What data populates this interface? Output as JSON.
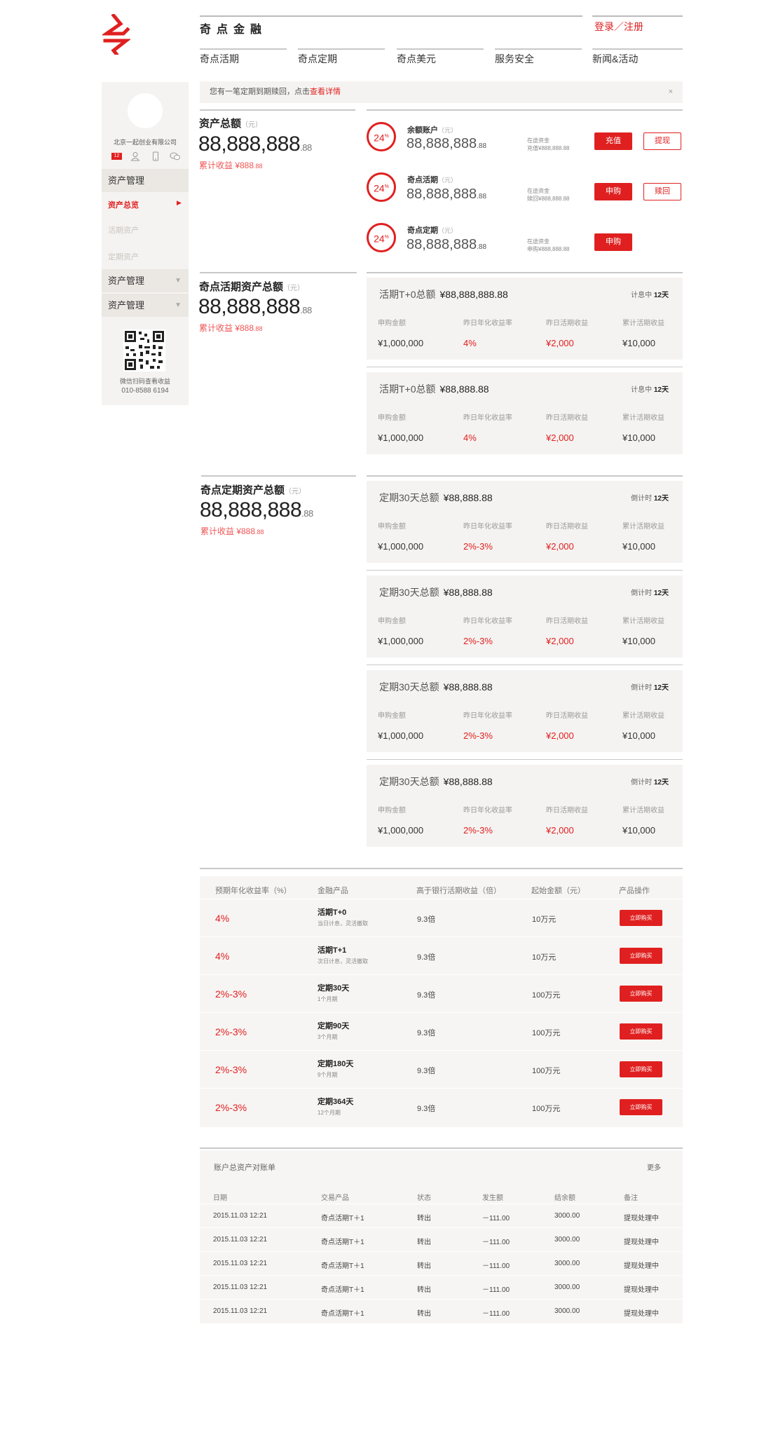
{
  "brand": {
    "name": "奇点金融",
    "logo_icon": "qidian-logo-icon",
    "accent": "#e02020"
  },
  "header": {
    "login_label": "登录／注册",
    "nav": [
      "奇点活期",
      "奇点定期",
      "奇点美元",
      "服务安全",
      "新闻&活动"
    ]
  },
  "sidebar": {
    "company": "北京一起创业有限公司",
    "message_count": "12",
    "icons": [
      "message-icon",
      "user-icon",
      "phone-icon",
      "wechat-icon"
    ],
    "sections": [
      {
        "label": "资产管理",
        "expanded": true,
        "items": [
          {
            "label": "资产总览",
            "active": true
          },
          {
            "label": "活期资产",
            "active": false
          },
          {
            "label": "定期资产",
            "active": false
          }
        ]
      },
      {
        "label": "资产管理",
        "expanded": false
      },
      {
        "label": "资产管理",
        "expanded": false
      }
    ],
    "qr_caption": "微信扫码查看收益",
    "phone": "010-8588 6194"
  },
  "notice": {
    "text": "您有一笔定期到期赎回，点击",
    "link": "查看详情",
    "close": "×"
  },
  "total": {
    "title": "资产总额",
    "unit": "（元）",
    "amount": "88,888,888",
    "cents": ".88",
    "cum_label": "累计收益 ¥888",
    "cum_cents": ".88"
  },
  "accounts": [
    {
      "rate": "24",
      "rate_unit": "%",
      "name": "余额账户",
      "unit": "（元）",
      "amount": "88,888,888",
      "cents": ".88",
      "meta1": "在途资金",
      "meta2": "充值¥888,888.88",
      "btn1": "充值",
      "btn2": "提现"
    },
    {
      "rate": "24",
      "rate_unit": "%",
      "name": "奇点活期",
      "unit": "（元）",
      "amount": "88,888,888",
      "cents": ".88",
      "meta1": "在途资金",
      "meta2": "赎回¥888,888.88",
      "btn1": "申购",
      "btn2": "赎回"
    },
    {
      "rate": "24",
      "rate_unit": "%",
      "name": "奇点定期",
      "unit": "（元）",
      "amount": "88,888,888",
      "cents": ".88",
      "meta1": "在途资金",
      "meta2": "申购¥888,888.88",
      "btn1": "申购",
      "btn2": ""
    }
  ],
  "current_section": {
    "title": "奇点活期资产总额",
    "unit": "（元）",
    "amount": "88,888,888",
    "cents": ".88",
    "cum_label": "累计收益 ¥888",
    "cum_cents": ".88"
  },
  "current_cards": [
    {
      "title": "活期T+0总额",
      "total": "¥88,888,888.88",
      "status": "计息中",
      "days": "12天",
      "labels": [
        "申购金额",
        "昨日年化收益率",
        "昨日活期收益",
        "累计活期收益"
      ],
      "values": [
        "¥1,000,000",
        "4%",
        "¥2,000",
        "¥10,000"
      ]
    },
    {
      "title": "活期T+0总额",
      "total": "¥88,888.88",
      "status": "计息中",
      "days": "12天",
      "labels": [
        "申购金额",
        "昨日年化收益率",
        "昨日活期收益",
        "累计活期收益"
      ],
      "values": [
        "¥1,000,000",
        "4%",
        "¥2,000",
        "¥10,000"
      ]
    }
  ],
  "fixed_section": {
    "title": "奇点定期资产总额",
    "unit": "（元）",
    "amount": "88,888,888",
    "cents": ".88",
    "cum_label": "累计收益 ¥888",
    "cum_cents": ".88"
  },
  "fixed_cards": [
    {
      "title": "定期30天总额",
      "total": "¥88,888.88",
      "status": "倒计时",
      "days": "12天",
      "labels": [
        "申购金额",
        "昨日年化收益率",
        "昨日活期收益",
        "累计活期收益"
      ],
      "values": [
        "¥1,000,000",
        "2%-3%",
        "¥2,000",
        "¥10,000"
      ]
    },
    {
      "title": "定期30天总额",
      "total": "¥88,888.88",
      "status": "倒计时",
      "days": "12天",
      "labels": [
        "申购金额",
        "昨日年化收益率",
        "昨日活期收益",
        "累计活期收益"
      ],
      "values": [
        "¥1,000,000",
        "2%-3%",
        "¥2,000",
        "¥10,000"
      ]
    },
    {
      "title": "定期30天总额",
      "total": "¥88,888.88",
      "status": "倒计时",
      "days": "12天",
      "labels": [
        "申购金额",
        "昨日年化收益率",
        "昨日活期收益",
        "累计活期收益"
      ],
      "values": [
        "¥1,000,000",
        "2%-3%",
        "¥2,000",
        "¥10,000"
      ]
    },
    {
      "title": "定期30天总额",
      "total": "¥88,888.88",
      "status": "倒计时",
      "days": "12天",
      "labels": [
        "申购金额",
        "昨日年化收益率",
        "昨日活期收益",
        "累计活期收益"
      ],
      "values": [
        "¥1,000,000",
        "2%-3%",
        "¥2,000",
        "¥10,000"
      ]
    }
  ],
  "products": {
    "headers": [
      "预期年化收益率（%）",
      "金融产品",
      "高于银行活期收益（倍）",
      "起始金额（元）",
      "产品操作"
    ],
    "rows": [
      {
        "rate": "4%",
        "name": "活期T+0",
        "sub": "当日计息，灵活撤取",
        "multiple": "9.3倍",
        "min": "10万元",
        "action": "立即购买"
      },
      {
        "rate": "4%",
        "name": "活期T+1",
        "sub": "次日计息，灵活撤取",
        "multiple": "9.3倍",
        "min": "10万元",
        "action": "立即购买"
      },
      {
        "rate": "2%-3%",
        "name": "定期30天",
        "sub": "1个月期",
        "multiple": "9.3倍",
        "min": "100万元",
        "action": "立即购买"
      },
      {
        "rate": "2%-3%",
        "name": "定期90天",
        "sub": "3个月期",
        "multiple": "9.3倍",
        "min": "100万元",
        "action": "立即购买"
      },
      {
        "rate": "2%-3%",
        "name": "定期180天",
        "sub": "9个月期",
        "multiple": "9.3倍",
        "min": "100万元",
        "action": "立即购买"
      },
      {
        "rate": "2%-3%",
        "name": "定期364天",
        "sub": "12个月期",
        "multiple": "9.3倍",
        "min": "100万元",
        "action": "立即购买"
      }
    ]
  },
  "statement": {
    "title": "账户总资产对账单",
    "more": "更多",
    "headers": [
      "日期",
      "交易产品",
      "状态",
      "发生额",
      "结余额",
      "备注"
    ],
    "rows": [
      [
        "2015.11.03 12:21",
        "奇点活期T＋1",
        "转出",
        "－111.00",
        "3000.00",
        "提现处理中"
      ],
      [
        "2015.11.03 12:21",
        "奇点活期T＋1",
        "转出",
        "－111.00",
        "3000.00",
        "提现处理中"
      ],
      [
        "2015.11.03 12:21",
        "奇点活期T＋1",
        "转出",
        "－111.00",
        "3000.00",
        "提现处理中"
      ],
      [
        "2015.11.03 12:21",
        "奇点活期T＋1",
        "转出",
        "－111.00",
        "3000.00",
        "提现处理中"
      ],
      [
        "2015.11.03 12:21",
        "奇点活期T＋1",
        "转出",
        "－111.00",
        "3000.00",
        "提现处理中"
      ]
    ]
  }
}
